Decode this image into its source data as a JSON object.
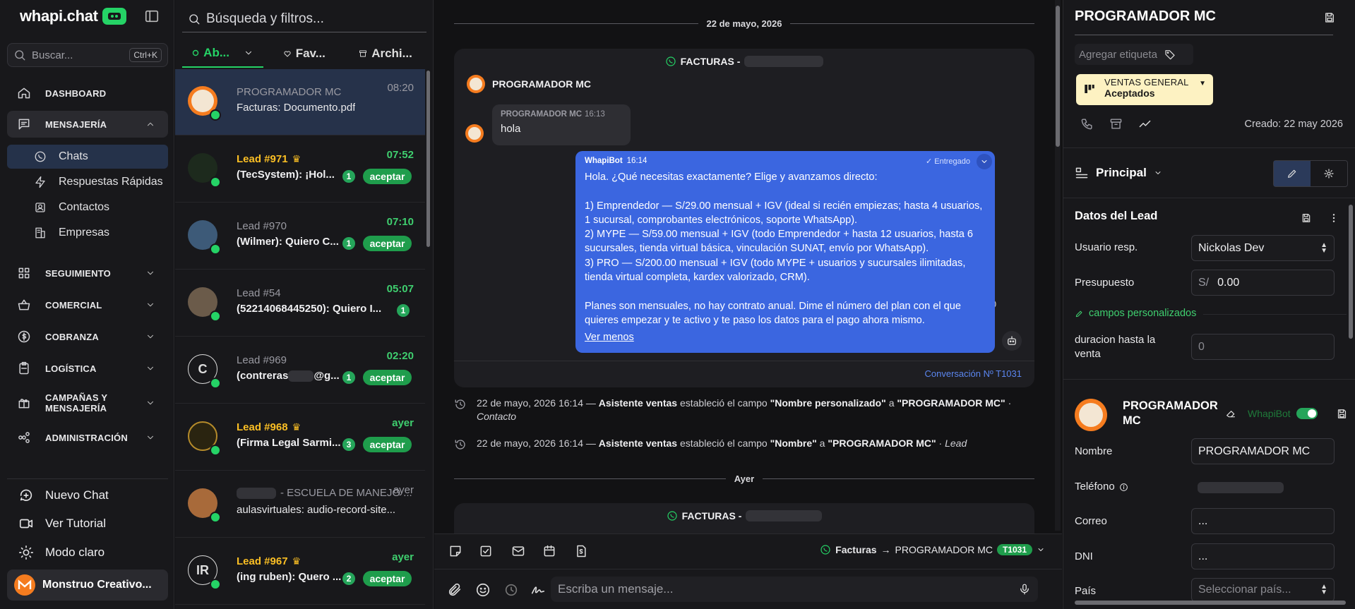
{
  "brand": {
    "name": "whapi.chat"
  },
  "sidebar": {
    "search_placeholder": "Buscar...",
    "search_shortcut": "Ctrl+K",
    "nav": [
      {
        "label": "DASHBOARD",
        "icon": "home-icon"
      },
      {
        "label": "MENSAJERÍA",
        "icon": "message-square-icon"
      },
      {
        "label": "SEGUIMIENTO",
        "icon": "grid-icon"
      },
      {
        "label": "COMERCIAL",
        "icon": "basket-icon"
      },
      {
        "label": "COBRANZA",
        "icon": "dollar-circle-icon"
      },
      {
        "label": "LOGÍSTICA",
        "icon": "clipboard-icon"
      },
      {
        "label": "CAMPAÑAS Y MENSAJERÍA",
        "icon": "gift-icon"
      },
      {
        "label": "ADMINISTRACIÓN",
        "icon": "nodes-icon"
      }
    ],
    "sub": [
      {
        "label": "Chats",
        "icon": "whatsapp-icon"
      },
      {
        "label": "Respuestas Rápidas",
        "icon": "zap-icon"
      },
      {
        "label": "Contactos",
        "icon": "contact-card-icon"
      },
      {
        "label": "Empresas",
        "icon": "building-icon"
      }
    ],
    "bottom": [
      {
        "label": "Nuevo Chat",
        "icon": "chat-add-icon"
      },
      {
        "label": "Ver Tutorial",
        "icon": "video-icon"
      },
      {
        "label": "Modo claro",
        "icon": "sun-icon"
      }
    ],
    "account_name": "Monstruo Creativo..."
  },
  "chatlist": {
    "search_placeholder": "Búsqueda y filtros...",
    "tabs": [
      "Ab...",
      "Fav...",
      "Archi..."
    ],
    "accept_label": "aceptar",
    "chats": [
      {
        "name": "PROGRAMADOR MC",
        "message": "Facturas: Documento.pdf",
        "time": "08:20"
      },
      {
        "name": "Lead #971",
        "message": "(TecSystem): ¡Hol...",
        "time": "07:52",
        "count": "1"
      },
      {
        "name": "Lead #970",
        "message": "(Wilmer): Quiero C...",
        "time": "07:10",
        "count": "1"
      },
      {
        "name": "Lead #54",
        "message": "(52214068445250): Quiero I...",
        "time": "05:07",
        "count": "1"
      },
      {
        "name": "Lead #969",
        "message_pre": "(contreras",
        "message_post": "@g...",
        "time": "02:20",
        "count": "1",
        "initial": "C"
      },
      {
        "name": "Lead #968",
        "message": "(Firma Legal Sarmi...",
        "time": "ayer",
        "count": "3"
      },
      {
        "name": "- ESCUELA DE MANEJO ...",
        "message": "aulasvirtuales: audio-record-site...",
        "time": "ayer"
      },
      {
        "name": "Lead #967",
        "message": "(ing ruben): Quero ...",
        "time": "ayer",
        "count": "2",
        "initial": "IR"
      }
    ]
  },
  "conversation": {
    "date1": "22 de mayo, 2026",
    "channel_prefix": "FACTURAS -",
    "contact_name": "PROGRAMADOR MC",
    "incoming": {
      "sender": "PROGRAMADOR MC",
      "time": "16:13",
      "text": "hola"
    },
    "outgoing": {
      "sender": "WhapiBot",
      "time": "16:14",
      "status": "Entregado",
      "text": "Hola. ¿Qué necesitas exactamente? Elige y avanzamos directo:\n\n1) Emprendedor — S/29.00 mensual + IGV (ideal si recién empiezas; hasta 4 usuarios, 1 sucursal, comprobantes electrónicos, soporte WhatsApp).\n2) MYPE — S/59.00 mensual + IGV (todo Emprendedor + hasta 12 usuarios, hasta 6 sucursales, tienda virtual básica, vinculación SUNAT, envío por WhatsApp).\n3) PRO — S/200.00 mensual + IGV (todo MYPE + usuarios y sucursales ilimitadas, tienda virtual completa, kardex valorizado, CRM).\n\nPlanes son mensuales, no hay contrato anual. Dime el número del plan con el que quieres empezar y te activo y te paso los datos para el pago ahora mismo.",
      "more": "Ver menos"
    },
    "conversation_no": "Conversación Nº T1031",
    "events": [
      {
        "date": "22 de mayo, 2026 16:14 —",
        "actor": "Asistente ventas",
        "verb": "estableció el campo",
        "field": "\"Nombre personalizado\"",
        "to": "a",
        "value": "\"PROGRAMADOR MC\"",
        "sep": "·",
        "entity": "Contacto"
      },
      {
        "date": "22 de mayo, 2026 16:14 —",
        "actor": "Asistente ventas",
        "verb": "estableció el campo",
        "field": "\"Nombre\"",
        "to": "a",
        "value": "\"PROGRAMADOR MC\"",
        "sep": "·",
        "entity": "Lead"
      }
    ],
    "date2": "Ayer",
    "route": {
      "channel": "Facturas",
      "arrow": "→",
      "target": "PROGRAMADOR MC",
      "tag": "T1031"
    },
    "composer_placeholder": "Escriba un mensaje..."
  },
  "details": {
    "title": "PROGRAMADOR MC",
    "tag_placeholder": "Agregar etiqueta",
    "funnel_name": "VENTAS GENERAL",
    "funnel_stage": "Aceptados",
    "created": "Creado: 22 may 2026",
    "view": "Principal",
    "section_title": "Datos del Lead",
    "fields": {
      "owner_label": "Usuario resp.",
      "owner_value": "Nickolas Dev",
      "budget_label": "Presupuesto",
      "budget_prefix": "S/",
      "budget_value": "0.00",
      "custom_link": "campos personalizados",
      "duration_label": "duracion hasta la venta",
      "duration_value": "0"
    },
    "contact": {
      "name": "PROGRAMADOR MC",
      "bot_label": "WhapiBot",
      "bot_enabled": true,
      "name_label": "Nombre",
      "name_value": "PROGRAMADOR MC",
      "phone_label": "Teléfono",
      "email_label": "Correo",
      "email_value": "...",
      "dni_label": "DNI",
      "dni_value": "...",
      "country_label": "País",
      "country_placeholder": "Seleccionar país..."
    }
  }
}
